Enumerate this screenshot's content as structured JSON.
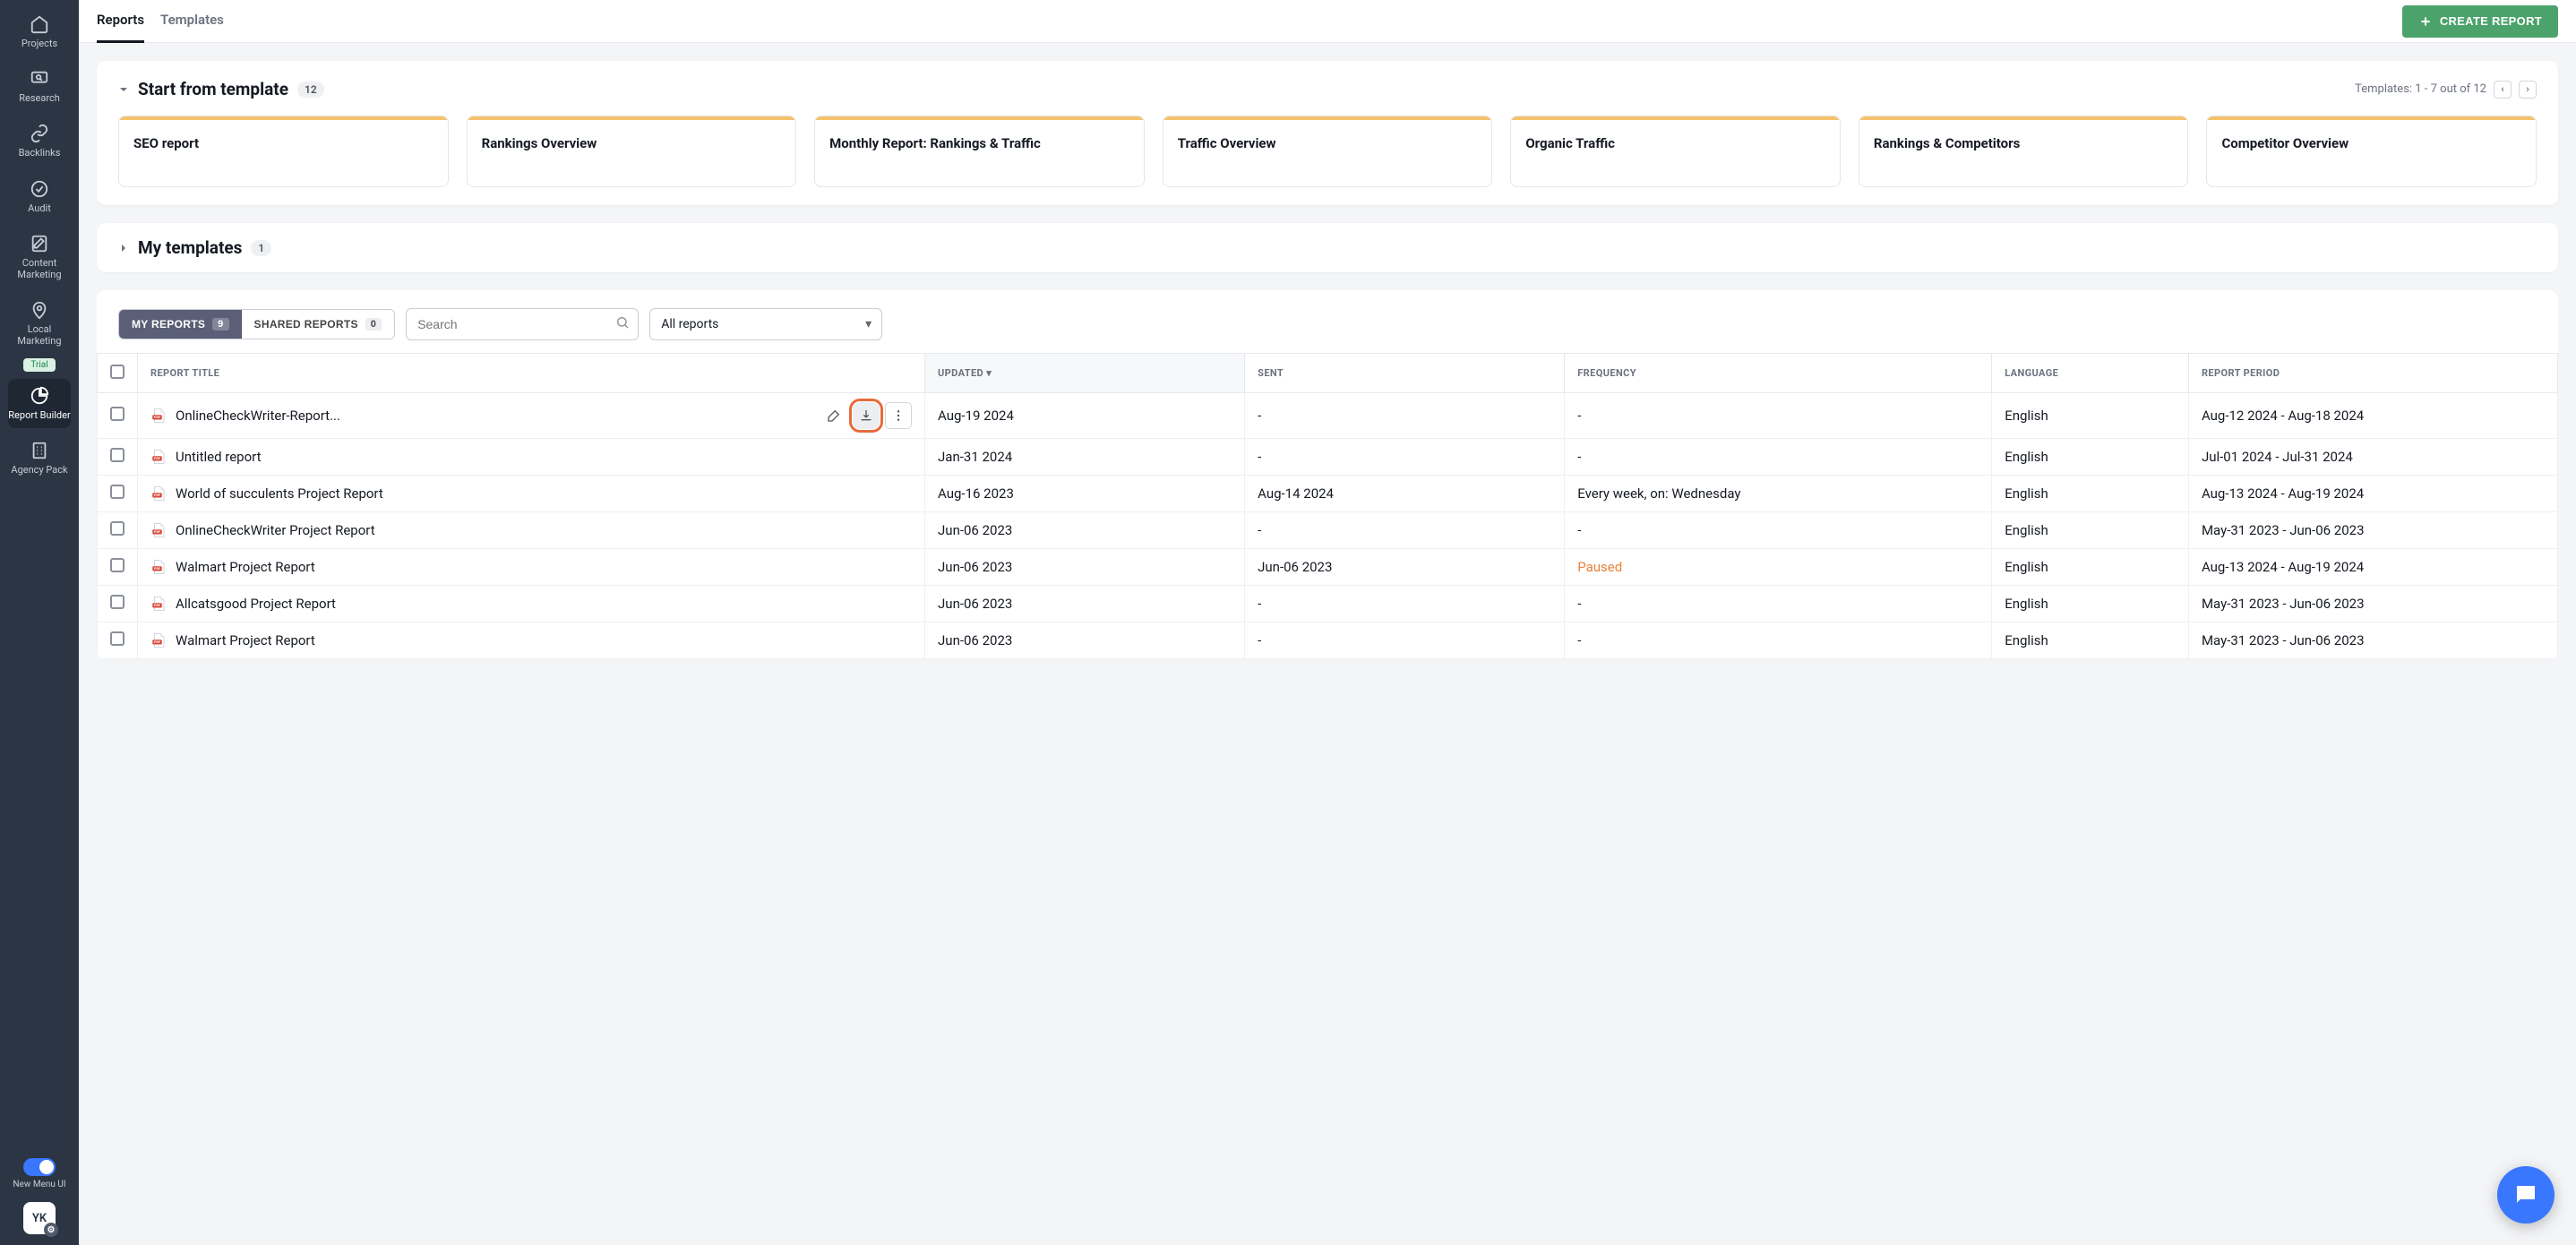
{
  "sidebar": {
    "items": [
      {
        "label": "Projects",
        "icon": "home"
      },
      {
        "label": "Research",
        "icon": "monitor-search"
      },
      {
        "label": "Backlinks",
        "icon": "link"
      },
      {
        "label": "Audit",
        "icon": "check-circle"
      },
      {
        "label": "Content Marketing",
        "icon": "edit-doc"
      },
      {
        "label": "Local Marketing",
        "icon": "map-pin"
      }
    ],
    "trial_label": "Trial",
    "active": {
      "label": "Report Builder",
      "icon": "pie-chart"
    },
    "agency": {
      "label": "Agency Pack",
      "icon": "building"
    },
    "toggle_label": "New Menu UI",
    "avatar": "YK"
  },
  "topbar": {
    "tabs": [
      {
        "label": "Reports",
        "active": true
      },
      {
        "label": "Templates",
        "active": false
      }
    ],
    "create_label": "CREATE REPORT"
  },
  "templates_section": {
    "title": "Start from template",
    "count": "12",
    "info": "Templates: 1 - 7 out of 12",
    "cards": [
      "SEO report",
      "Rankings Overview",
      "Monthly Report: Rankings & Traffic",
      "Traffic Overview",
      "Organic Traffic",
      "Rankings & Competitors",
      "Competitor Overview"
    ]
  },
  "my_templates": {
    "title": "My templates",
    "count": "1"
  },
  "filters": {
    "my_reports_label": "MY REPORTS",
    "my_reports_count": "9",
    "shared_label": "SHARED REPORTS",
    "shared_count": "0",
    "search_placeholder": "Search",
    "dropdown_value": "All reports"
  },
  "table": {
    "headers": {
      "title": "REPORT TITLE",
      "updated": "UPDATED",
      "sent": "SENT",
      "frequency": "FREQUENCY",
      "language": "LANGUAGE",
      "period": "REPORT PERIOD"
    },
    "rows": [
      {
        "title": "OnlineCheckWriter-Report...",
        "updated": "Aug-19 2024",
        "sent": "-",
        "frequency": "-",
        "language": "English",
        "period": "Aug-12 2024 - Aug-18 2024",
        "hover": true
      },
      {
        "title": "Untitled report",
        "updated": "Jan-31 2024",
        "sent": "-",
        "frequency": "-",
        "language": "English",
        "period": "Jul-01 2024 - Jul-31 2024"
      },
      {
        "title": "World of succulents Project Report",
        "updated": "Aug-16 2023",
        "sent": "Aug-14 2024",
        "frequency": "Every week, on: Wednesday",
        "language": "English",
        "period": "Aug-13 2024 - Aug-19 2024"
      },
      {
        "title": "OnlineCheckWriter Project Report",
        "updated": "Jun-06 2023",
        "sent": "-",
        "frequency": "-",
        "language": "English",
        "period": "May-31 2023 - Jun-06 2023"
      },
      {
        "title": "Walmart Project Report",
        "updated": "Jun-06 2023",
        "sent": "Jun-06 2023",
        "frequency": "Paused",
        "language": "English",
        "period": "Aug-13 2024 - Aug-19 2024",
        "paused": true
      },
      {
        "title": "Allcatsgood Project Report",
        "updated": "Jun-06 2023",
        "sent": "-",
        "frequency": "-",
        "language": "English",
        "period": "May-31 2023 - Jun-06 2023"
      },
      {
        "title": "Walmart Project Report",
        "updated": "Jun-06 2023",
        "sent": "-",
        "frequency": "-",
        "language": "English",
        "period": "May-31 2023 - Jun-06 2023"
      }
    ]
  }
}
